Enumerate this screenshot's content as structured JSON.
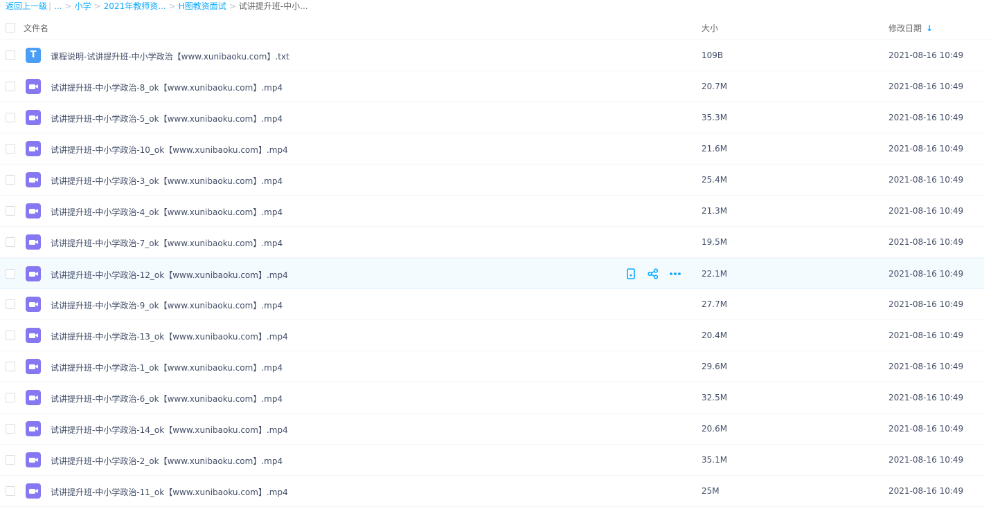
{
  "breadcrumb": {
    "back": "返回上一级",
    "divider": "|",
    "ellipsis": "...",
    "items": [
      "小学",
      "2021年教师资...",
      "H图教资面试"
    ],
    "current": "试讲提升班-中小...",
    "separator": ">"
  },
  "header": {
    "name": "文件名",
    "size": "大小",
    "date": "修改日期",
    "sort_arrow": "↓"
  },
  "colors": {
    "accent": "#09aaff",
    "txt_icon": "#4a9ef7",
    "video_icon": "#8678f0"
  },
  "files": [
    {
      "name": "课程说明-试讲提升班-中小学政治【www.xunibaoku.com】.txt",
      "size": "109B",
      "date": "2021-08-16 10:49",
      "icon": "txt-file-icon"
    },
    {
      "name": "试讲提升班-中小学政治-8_ok【www.xunibaoku.com】.mp4",
      "size": "20.7M",
      "date": "2021-08-16 10:49",
      "icon": "video-file-icon"
    },
    {
      "name": "试讲提升班-中小学政治-5_ok【www.xunibaoku.com】.mp4",
      "size": "35.3M",
      "date": "2021-08-16 10:49",
      "icon": "video-file-icon"
    },
    {
      "name": "试讲提升班-中小学政治-10_ok【www.xunibaoku.com】.mp4",
      "size": "21.6M",
      "date": "2021-08-16 10:49",
      "icon": "video-file-icon"
    },
    {
      "name": "试讲提升班-中小学政治-3_ok【www.xunibaoku.com】.mp4",
      "size": "25.4M",
      "date": "2021-08-16 10:49",
      "icon": "video-file-icon"
    },
    {
      "name": "试讲提升班-中小学政治-4_ok【www.xunibaoku.com】.mp4",
      "size": "21.3M",
      "date": "2021-08-16 10:49",
      "icon": "video-file-icon"
    },
    {
      "name": "试讲提升班-中小学政治-7_ok【www.xunibaoku.com】.mp4",
      "size": "19.5M",
      "date": "2021-08-16 10:49",
      "icon": "video-file-icon"
    },
    {
      "name": "试讲提升班-中小学政治-12_ok【www.xunibaoku.com】.mp4",
      "size": "22.1M",
      "date": "2021-08-16 10:49",
      "icon": "video-file-icon",
      "hover": true
    },
    {
      "name": "试讲提升班-中小学政治-9_ok【www.xunibaoku.com】.mp4",
      "size": "27.7M",
      "date": "2021-08-16 10:49",
      "icon": "video-file-icon"
    },
    {
      "name": "试讲提升班-中小学政治-13_ok【www.xunibaoku.com】.mp4",
      "size": "20.4M",
      "date": "2021-08-16 10:49",
      "icon": "video-file-icon"
    },
    {
      "name": "试讲提升班-中小学政治-1_ok【www.xunibaoku.com】.mp4",
      "size": "29.6M",
      "date": "2021-08-16 10:49",
      "icon": "video-file-icon"
    },
    {
      "name": "试讲提升班-中小学政治-6_ok【www.xunibaoku.com】.mp4",
      "size": "32.5M",
      "date": "2021-08-16 10:49",
      "icon": "video-file-icon"
    },
    {
      "name": "试讲提升班-中小学政治-14_ok【www.xunibaoku.com】.mp4",
      "size": "20.6M",
      "date": "2021-08-16 10:49",
      "icon": "video-file-icon"
    },
    {
      "name": "试讲提升班-中小学政治-2_ok【www.xunibaoku.com】.mp4",
      "size": "35.1M",
      "date": "2021-08-16 10:49",
      "icon": "video-file-icon"
    },
    {
      "name": "试讲提升班-中小学政治-11_ok【www.xunibaoku.com】.mp4",
      "size": "25M",
      "date": "2021-08-16 10:49",
      "icon": "video-file-icon"
    }
  ],
  "row_actions": [
    "phone-icon",
    "share-icon",
    "more-icon"
  ]
}
